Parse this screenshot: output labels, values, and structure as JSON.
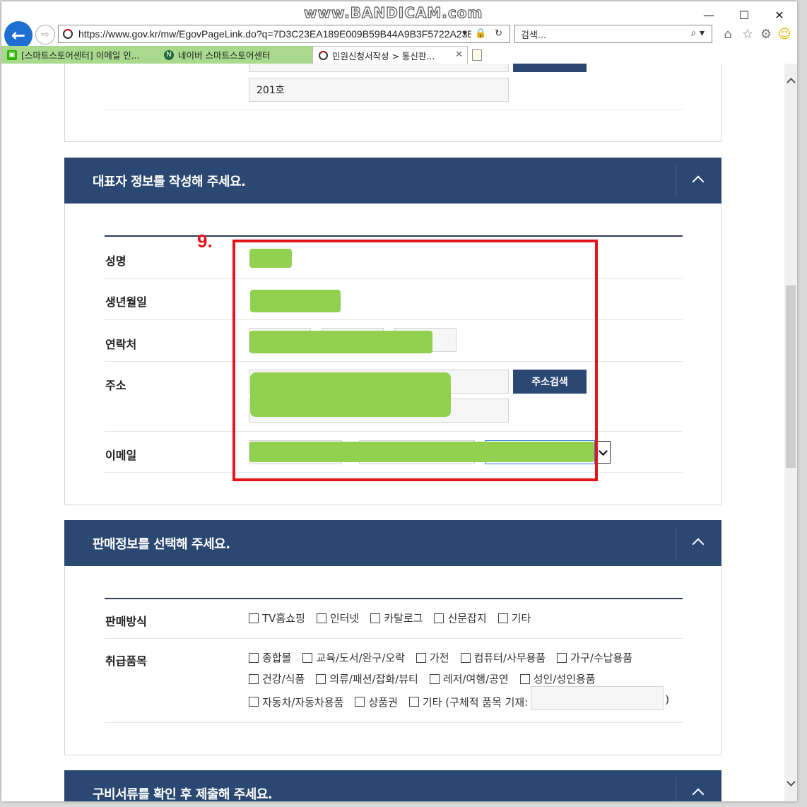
{
  "browser": {
    "watermark": "www.BANDICAM.com",
    "url": "https://www.gov.kr/mw/EgovPageLink.do?q=7D3C23EA189E009B59B44A9B3F5722A23B59",
    "address_controls": "▾ 🔒 ↻",
    "search_placeholder": "검색...",
    "tabs": [
      {
        "label": "[스마트스토어센터] 이메일 인..."
      },
      {
        "label": "네이버 스마트스토어센터"
      },
      {
        "label": "민원신청서작성 > 통신판..."
      }
    ]
  },
  "prev_section": {
    "detail_address": "201호"
  },
  "rep_section": {
    "title": "대표자 정보를 작성해 주세요.",
    "step_marker": "9.",
    "labels": {
      "name": "성명",
      "birth": "생년월일",
      "contact": "연락처",
      "address": "주소",
      "email": "이메일"
    },
    "address_search_button": "주소검색"
  },
  "sales_section": {
    "title": "판매정보를 선택해 주세요.",
    "method_label": "판매방식",
    "methods": [
      "TV홈쇼핑",
      "인터넷",
      "카탈로그",
      "신문잡지",
      "기타"
    ],
    "items_label": "취급품목",
    "items_row1": [
      "종합몰",
      "교육/도서/완구/오락",
      "가전",
      "컴퓨터/사무용품",
      "가구/수납용품"
    ],
    "items_row2": [
      "건강/식품",
      "의류/패션/잡화/뷰티",
      "레저/여행/공연",
      "성인/성인용품"
    ],
    "items_row3": [
      "자동차/자동차용품",
      "상품권"
    ],
    "etc_label": "기타 (구체적 품목 기재:",
    "etc_close": ")"
  },
  "docs_section": {
    "title": "구비서류를 확인 후 제출해 주세요."
  },
  "colors": {
    "navy": "#2a4872",
    "redact_green": "#92d050",
    "highlight_red": "#e3141a"
  }
}
